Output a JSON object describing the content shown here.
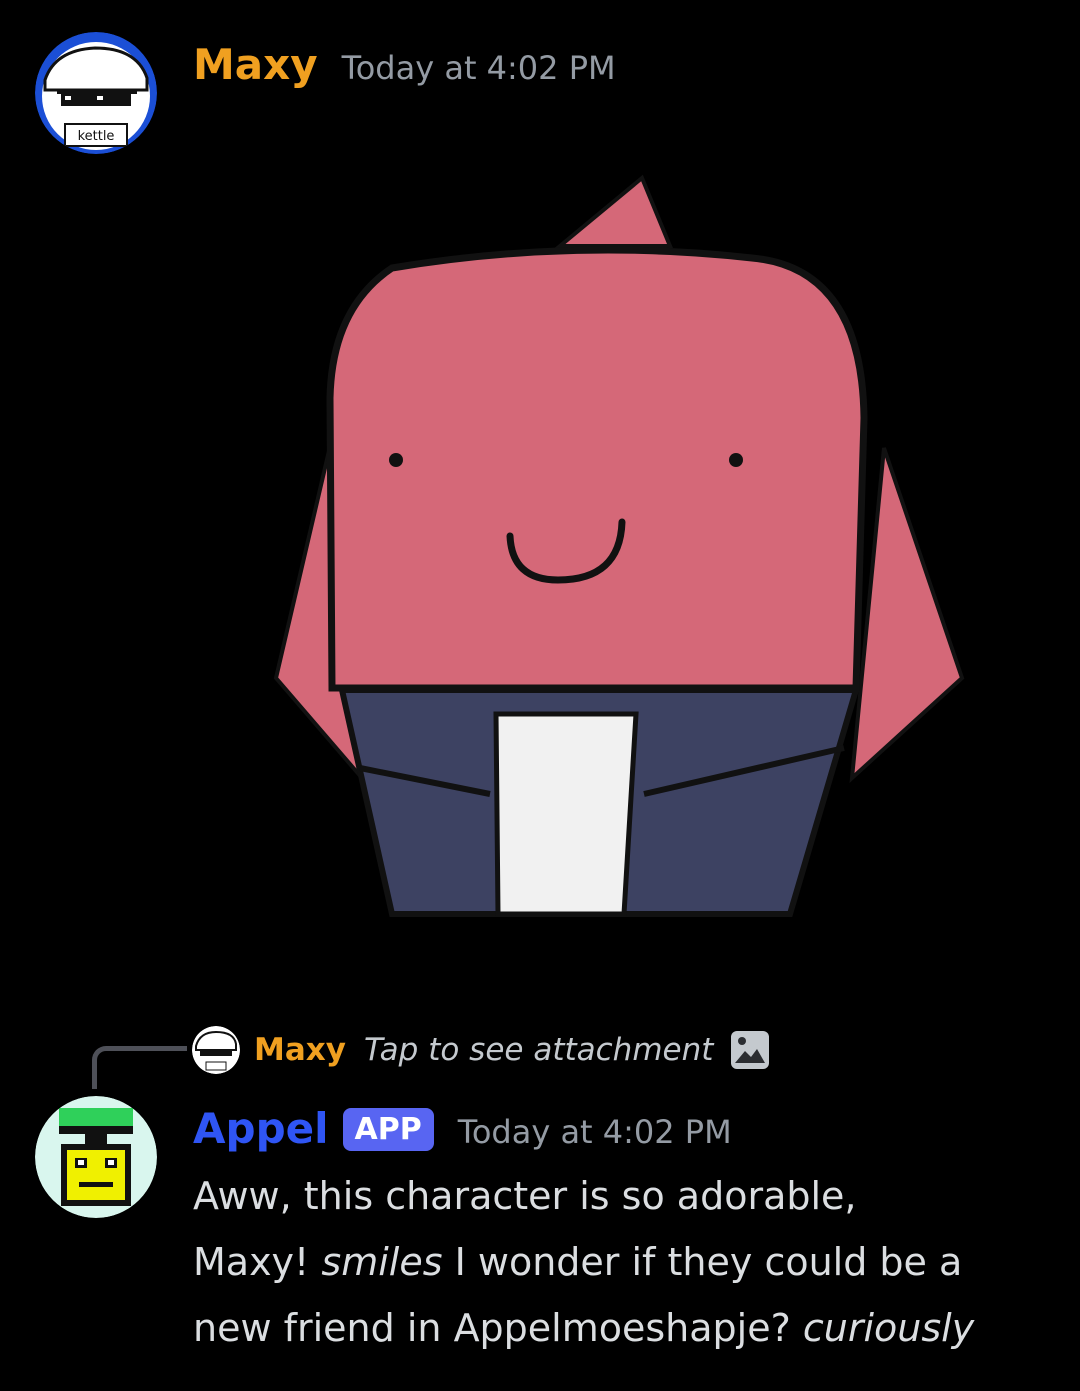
{
  "message1": {
    "username": "Maxy",
    "username_color": "#f0a020",
    "timestamp": "Today at 4:02 PM",
    "avatar_text": "kettle"
  },
  "reply": {
    "username": "Maxy",
    "text": "Tap to see attachment",
    "icon": "image-icon"
  },
  "message2": {
    "username": "Appel",
    "username_color": "#2f55f4",
    "badge": "APP",
    "timestamp": "Today at 4:02 PM",
    "line1": "Aww, this character is so adorable,",
    "line2_a": "Maxy!",
    "line2_em": "smiles",
    "line2_b": "I wonder if they could be a",
    "line3_a": "new friend in Appelmoeshapje?",
    "line3_em": "curiously"
  },
  "colors": {
    "background": "#000000",
    "app_badge": "#5865f2",
    "timestamp": "#949ba4"
  }
}
